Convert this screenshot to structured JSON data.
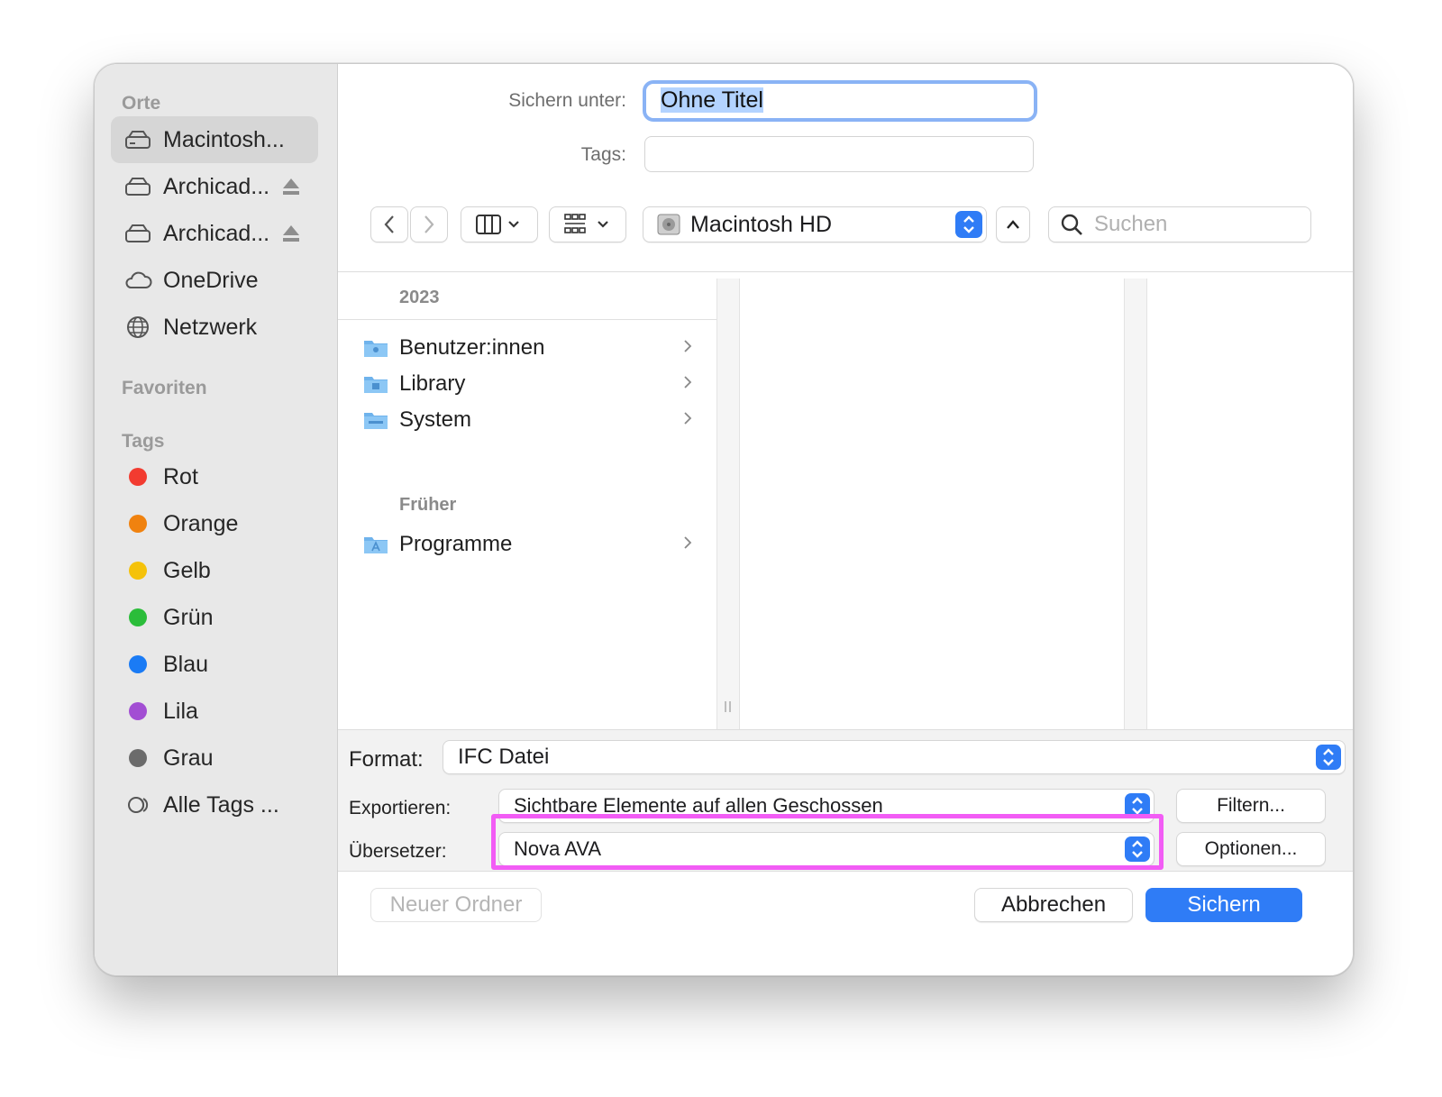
{
  "dialog": {
    "save_as_label": "Sichern unter:",
    "save_as_value": "Ohne Titel",
    "tags_label": "Tags:",
    "tags_value": ""
  },
  "sidebar": {
    "sections": {
      "places": "Orte",
      "favorites": "Favoriten",
      "tags": "Tags"
    },
    "places": [
      {
        "label": "Macintosh...",
        "icon": "drive-icon",
        "selected": true
      },
      {
        "label": "Archicad...",
        "icon": "drive-icon",
        "eject": true
      },
      {
        "label": "Archicad...",
        "icon": "drive-icon",
        "eject": true
      },
      {
        "label": "OneDrive",
        "icon": "cloud-icon"
      },
      {
        "label": "Netzwerk",
        "icon": "globe-icon"
      }
    ],
    "tags": [
      {
        "label": "Rot",
        "color": "#f23b30"
      },
      {
        "label": "Orange",
        "color": "#f0820f"
      },
      {
        "label": "Gelb",
        "color": "#f5c20a"
      },
      {
        "label": "Grün",
        "color": "#2bbd3a"
      },
      {
        "label": "Blau",
        "color": "#1a7bf5"
      },
      {
        "label": "Lila",
        "color": "#a24ed3"
      },
      {
        "label": "Grau",
        "color": "#6b6b6b"
      },
      {
        "label": "Alle Tags ...",
        "icon": "all-tags-icon"
      }
    ]
  },
  "toolbar": {
    "location": "Macintosh HD",
    "search_placeholder": "Suchen"
  },
  "browser": {
    "column1_header": "2023",
    "items": [
      {
        "label": "Benutzer:innen",
        "icon": "users-folder-icon"
      },
      {
        "label": "Library",
        "icon": "library-folder-icon"
      },
      {
        "label": "System",
        "icon": "system-folder-icon"
      }
    ],
    "earlier_header": "Früher",
    "earlier_items": [
      {
        "label": "Programme",
        "icon": "applications-folder-icon"
      }
    ]
  },
  "options": {
    "format_label": "Format:",
    "format_value": "IFC Datei",
    "export_label": "Exportieren:",
    "export_value": "Sichtbare Elemente auf allen Geschossen",
    "filter_button": "Filtern...",
    "translator_label": "Übersetzer:",
    "translator_value": "Nova AVA",
    "options_button": "Optionen...",
    "highlight_color": "#f25cf5"
  },
  "footer": {
    "new_folder": "Neuer Ordner",
    "cancel": "Abbrechen",
    "save": "Sichern"
  }
}
